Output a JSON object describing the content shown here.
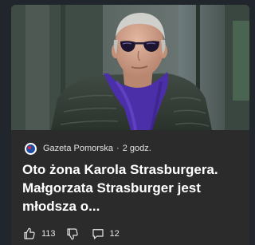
{
  "article": {
    "image_alt": "Older man with gray hair wearing sunglasses, green jacket and purple scarf",
    "source": {
      "logo_icon": "gazeta-pomorska-logo",
      "name": "Gazeta Pomorska"
    },
    "separator": "·",
    "time": "2 godz.",
    "headline": "Oto żona Karola Strasburgera. Małgorzata Strasburger jest młodsza o..."
  },
  "actions": {
    "like_icon": "thumbs-up-icon",
    "like_count": "113",
    "dislike_icon": "thumbs-down-icon",
    "comment_icon": "comment-icon",
    "comment_count": "12"
  },
  "colors": {
    "page_background": "#20262b",
    "card_background": "#2b2b2b",
    "text_primary": "#ffffff",
    "text_secondary": "#e3e3e3",
    "logo_blue": "#1f4ea3",
    "logo_red": "#e4262b"
  }
}
